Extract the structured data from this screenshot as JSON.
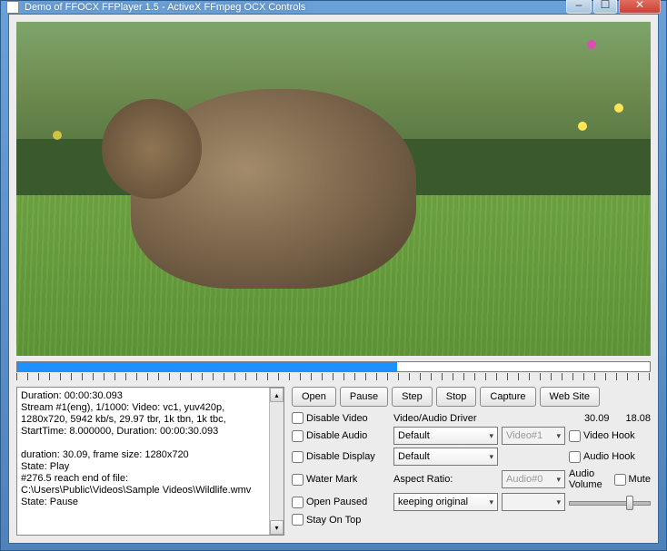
{
  "window": {
    "title": "Demo of FFOCX FFPlayer 1.5 - ActiveX FFmpeg OCX Controls"
  },
  "progress": {
    "percent": 60
  },
  "log": "Duration: 00:00:30.093\nStream #1(eng), 1/1000: Video: vc1, yuv420p, 1280x720, 5942 kb/s, 29.97 tbr, 1k tbn, 1k tbc, StartTime: 8.000000, Duration: 00:00:30.093\n\nduration: 30.09, frame size: 1280x720\nState: Play\n#276.5 reach end of file: C:\\Users\\Public\\Videos\\Sample Videos\\Wildlife.wmv\nState: Pause",
  "buttons": {
    "open": "Open",
    "pause": "Pause",
    "step": "Step",
    "stop": "Stop",
    "capture": "Capture",
    "website": "Web Site"
  },
  "checks": {
    "disable_video": "Disable Video",
    "disable_audio": "Disable Audio",
    "disable_display": "Disable Display",
    "water_mark": "Water Mark",
    "open_paused": "Open Paused",
    "stay_on_top": "Stay On Top",
    "video_hook": "Video Hook",
    "audio_hook": "Audio Hook",
    "mute": "Mute"
  },
  "labels": {
    "driver": "Video/Audio Driver",
    "aspect": "Aspect Ratio:",
    "volume": "Audio Volume"
  },
  "selects": {
    "driver1": "Default",
    "driver2": "Default",
    "aspect": "keeping original",
    "video_n": "Video#1",
    "audio_n": "Audio#0",
    "blank": ""
  },
  "times": {
    "total": "30.09",
    "current": "18.08"
  },
  "volume_percent": 70
}
